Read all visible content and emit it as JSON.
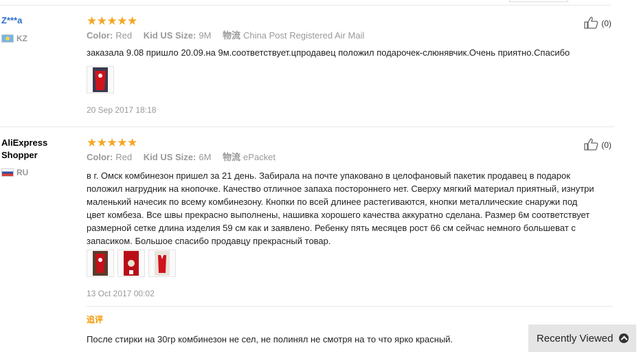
{
  "reviews": [
    {
      "user": "Z***a",
      "country": "KZ",
      "stars": "★★★★★",
      "rating": 5,
      "color_label": "Color:",
      "color_value": "Red",
      "size_label": "Kid US Size:",
      "size_value": "9M",
      "ship_label": "物流",
      "ship_value": "China Post Registered Air Mail",
      "likes": "(0)",
      "text": "заказала 9.08 пришло 20.09.на 9м.соответствует.цпродавец положил подарочек-слюнявчик.Очень приятно.Спасибо",
      "date": "20 Sep 2017 18:18"
    },
    {
      "user": "AliExpress Shopper",
      "country": "RU",
      "stars": "★★★★★",
      "rating": 5,
      "color_label": "Color:",
      "color_value": "Red",
      "size_label": "Kid US Size:",
      "size_value": "6M",
      "ship_label": "物流",
      "ship_value": "ePacket",
      "likes": "(0)",
      "text": "в г. Омск комбинезон пришел за 21 день. Забирала на почте упаковано в целофановый пакетик продавец в подарок положил нагрудник на кнопочке. Качество отличное запаха постороннего нет. Сверху мягкий материал приятный, изнутри маленький начесик по всему комбинезону. Кнопки по всей длинее растегиваются, кнопки металлические снаружи под цвет комбеза. Все швы прекрасно выполнены, нашивка хорошего качества аккуратно сделана. Размер 6м соответствует размерной сетке длина изделия 59 см как и заявлено. Ребенку пять месяцев рост 66 см сейчас немного большеват с запасиком. Большое спасибо продавцу прекрасный товар.",
      "date": "13 Oct 2017 00:02",
      "additional_label": "追评",
      "additional_text": "После стирки на 30гр комбинезон не сел, не полинял не смотря на то что ярко красный."
    }
  ],
  "recently_viewed": "Recently Viewed",
  "colors": {
    "accent_orange": "#f39800",
    "star": "#f5a623",
    "link_blue": "#2d6ecb"
  }
}
